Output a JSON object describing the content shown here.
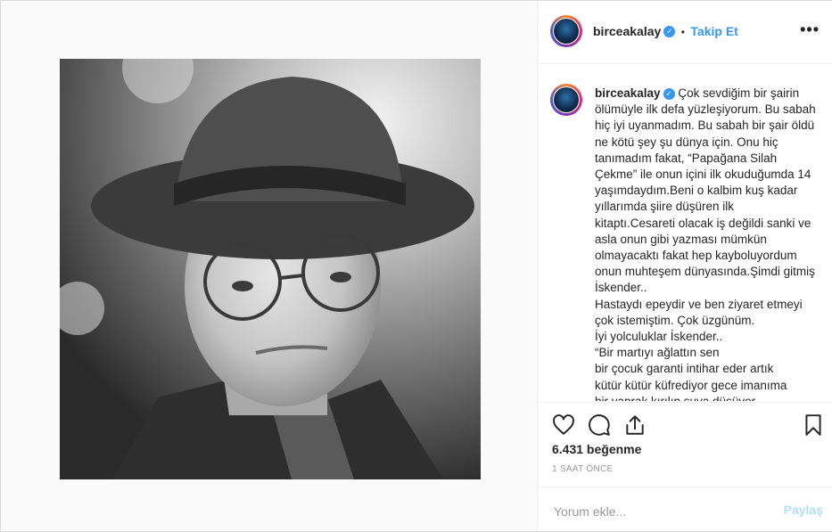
{
  "post": {
    "username": "birceakalay",
    "follow_label": "Takip Et",
    "separator": "•",
    "more_icon": "more-options-icon",
    "verified_icon": "verified-badge-icon",
    "caption_text": "Çok sevdiğim bir şairin ölümüyle ilk defa yüzleşiyorum. Bu sabah hiç iyi uyanmadım. Bu sabah bir şair öldü ne kötü şey şu dünya için. Onu hiç tanımadım fakat, “Papağana Silah Çekme” ile onun içini ilk okuduğumda 14 yaşımdaydım.Beni o kalbim kuş kadar yıllarımda şiire düşüren ilk kitaptı.Cesareti olacak iş değildi sanki ve asla onun gibi yazması mümkün olmayacaktı fakat hep kayboluyordum onun muhteşem dünyasında.Şimdi gitmiş İskender..\nHastaydı epeydir ve ben ziyaret etmeyi çok istemiştim. Çok üzgünüm.\nİyi yolculuklar İskender..\n“Bir martıyı ağlattın sen\nbir çocuk garanti intihar eder artık\nkütür kütür küfrediyor gece imanıma\nbir yaprak kırılıp suya düşüyor",
    "likes": "6.431 beğenme",
    "time": "1 SAAT ÖNCE",
    "comment_placeholder": "Yorum ekle...",
    "post_label": "Paylaş"
  },
  "icons": {
    "like": "heart-icon",
    "comment": "comment-icon",
    "share": "share-icon",
    "save": "bookmark-icon"
  },
  "colors": {
    "accent": "#3897f0",
    "post_disabled": "#b2dffc"
  }
}
